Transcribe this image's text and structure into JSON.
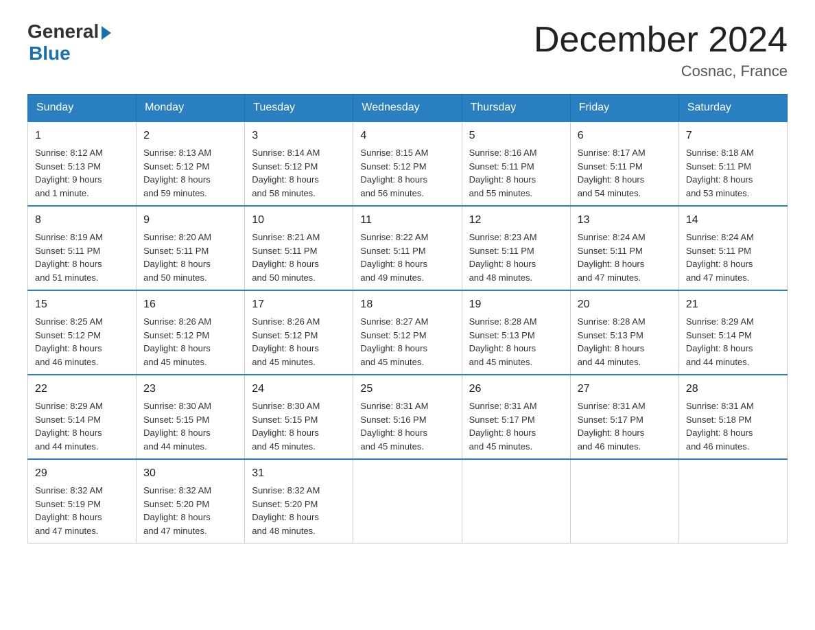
{
  "header": {
    "logo_general": "General",
    "logo_blue": "Blue",
    "month_title": "December 2024",
    "location": "Cosnac, France"
  },
  "weekdays": [
    "Sunday",
    "Monday",
    "Tuesday",
    "Wednesday",
    "Thursday",
    "Friday",
    "Saturday"
  ],
  "weeks": [
    [
      {
        "day": "1",
        "info": "Sunrise: 8:12 AM\nSunset: 5:13 PM\nDaylight: 9 hours\nand 1 minute."
      },
      {
        "day": "2",
        "info": "Sunrise: 8:13 AM\nSunset: 5:12 PM\nDaylight: 8 hours\nand 59 minutes."
      },
      {
        "day": "3",
        "info": "Sunrise: 8:14 AM\nSunset: 5:12 PM\nDaylight: 8 hours\nand 58 minutes."
      },
      {
        "day": "4",
        "info": "Sunrise: 8:15 AM\nSunset: 5:12 PM\nDaylight: 8 hours\nand 56 minutes."
      },
      {
        "day": "5",
        "info": "Sunrise: 8:16 AM\nSunset: 5:11 PM\nDaylight: 8 hours\nand 55 minutes."
      },
      {
        "day": "6",
        "info": "Sunrise: 8:17 AM\nSunset: 5:11 PM\nDaylight: 8 hours\nand 54 minutes."
      },
      {
        "day": "7",
        "info": "Sunrise: 8:18 AM\nSunset: 5:11 PM\nDaylight: 8 hours\nand 53 minutes."
      }
    ],
    [
      {
        "day": "8",
        "info": "Sunrise: 8:19 AM\nSunset: 5:11 PM\nDaylight: 8 hours\nand 51 minutes."
      },
      {
        "day": "9",
        "info": "Sunrise: 8:20 AM\nSunset: 5:11 PM\nDaylight: 8 hours\nand 50 minutes."
      },
      {
        "day": "10",
        "info": "Sunrise: 8:21 AM\nSunset: 5:11 PM\nDaylight: 8 hours\nand 50 minutes."
      },
      {
        "day": "11",
        "info": "Sunrise: 8:22 AM\nSunset: 5:11 PM\nDaylight: 8 hours\nand 49 minutes."
      },
      {
        "day": "12",
        "info": "Sunrise: 8:23 AM\nSunset: 5:11 PM\nDaylight: 8 hours\nand 48 minutes."
      },
      {
        "day": "13",
        "info": "Sunrise: 8:24 AM\nSunset: 5:11 PM\nDaylight: 8 hours\nand 47 minutes."
      },
      {
        "day": "14",
        "info": "Sunrise: 8:24 AM\nSunset: 5:11 PM\nDaylight: 8 hours\nand 47 minutes."
      }
    ],
    [
      {
        "day": "15",
        "info": "Sunrise: 8:25 AM\nSunset: 5:12 PM\nDaylight: 8 hours\nand 46 minutes."
      },
      {
        "day": "16",
        "info": "Sunrise: 8:26 AM\nSunset: 5:12 PM\nDaylight: 8 hours\nand 45 minutes."
      },
      {
        "day": "17",
        "info": "Sunrise: 8:26 AM\nSunset: 5:12 PM\nDaylight: 8 hours\nand 45 minutes."
      },
      {
        "day": "18",
        "info": "Sunrise: 8:27 AM\nSunset: 5:12 PM\nDaylight: 8 hours\nand 45 minutes."
      },
      {
        "day": "19",
        "info": "Sunrise: 8:28 AM\nSunset: 5:13 PM\nDaylight: 8 hours\nand 45 minutes."
      },
      {
        "day": "20",
        "info": "Sunrise: 8:28 AM\nSunset: 5:13 PM\nDaylight: 8 hours\nand 44 minutes."
      },
      {
        "day": "21",
        "info": "Sunrise: 8:29 AM\nSunset: 5:14 PM\nDaylight: 8 hours\nand 44 minutes."
      }
    ],
    [
      {
        "day": "22",
        "info": "Sunrise: 8:29 AM\nSunset: 5:14 PM\nDaylight: 8 hours\nand 44 minutes."
      },
      {
        "day": "23",
        "info": "Sunrise: 8:30 AM\nSunset: 5:15 PM\nDaylight: 8 hours\nand 44 minutes."
      },
      {
        "day": "24",
        "info": "Sunrise: 8:30 AM\nSunset: 5:15 PM\nDaylight: 8 hours\nand 45 minutes."
      },
      {
        "day": "25",
        "info": "Sunrise: 8:31 AM\nSunset: 5:16 PM\nDaylight: 8 hours\nand 45 minutes."
      },
      {
        "day": "26",
        "info": "Sunrise: 8:31 AM\nSunset: 5:17 PM\nDaylight: 8 hours\nand 45 minutes."
      },
      {
        "day": "27",
        "info": "Sunrise: 8:31 AM\nSunset: 5:17 PM\nDaylight: 8 hours\nand 46 minutes."
      },
      {
        "day": "28",
        "info": "Sunrise: 8:31 AM\nSunset: 5:18 PM\nDaylight: 8 hours\nand 46 minutes."
      }
    ],
    [
      {
        "day": "29",
        "info": "Sunrise: 8:32 AM\nSunset: 5:19 PM\nDaylight: 8 hours\nand 47 minutes."
      },
      {
        "day": "30",
        "info": "Sunrise: 8:32 AM\nSunset: 5:20 PM\nDaylight: 8 hours\nand 47 minutes."
      },
      {
        "day": "31",
        "info": "Sunrise: 8:32 AM\nSunset: 5:20 PM\nDaylight: 8 hours\nand 48 minutes."
      },
      {
        "day": "",
        "info": ""
      },
      {
        "day": "",
        "info": ""
      },
      {
        "day": "",
        "info": ""
      },
      {
        "day": "",
        "info": ""
      }
    ]
  ]
}
